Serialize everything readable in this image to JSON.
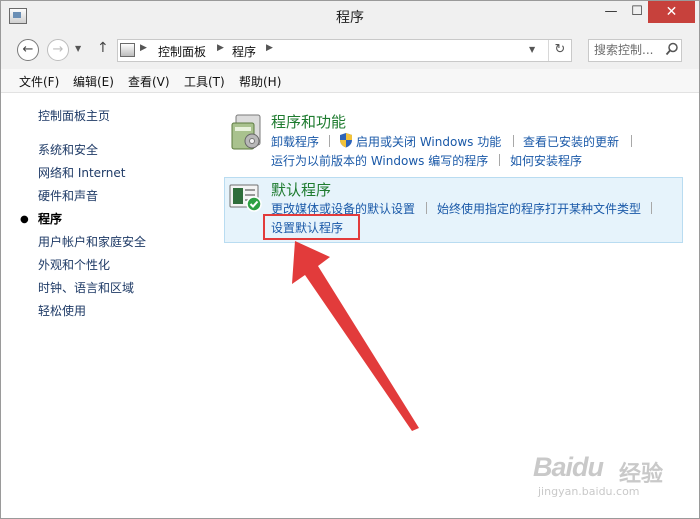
{
  "window": {
    "title": "程序",
    "controls": {
      "minimize": "—",
      "maximize": "☐",
      "close": "✕"
    }
  },
  "address": {
    "crumbs": [
      "控制面板",
      "程序"
    ],
    "search_placeholder": "搜索控制..."
  },
  "menu": [
    "文件(F)",
    "编辑(E)",
    "查看(V)",
    "工具(T)",
    "帮助(H)"
  ],
  "left_nav": {
    "items": [
      "控制面板主页",
      "系统和安全",
      "网络和 Internet",
      "硬件和声音",
      "程序",
      "用户帐户和家庭安全",
      "外观和个性化",
      "时钟、语言和区域",
      "轻松使用"
    ],
    "current_index": 4
  },
  "programs_features": {
    "title": "程序和功能",
    "links": [
      "卸载程序",
      "启用或关闭 Windows 功能",
      "查看已安装的更新",
      "运行为以前版本的 Windows 编写的程序",
      "如何安装程序"
    ]
  },
  "default_programs": {
    "title": "默认程序",
    "links": [
      "更改媒体或设备的默认设置",
      "始终使用指定的程序打开某种文件类型",
      "设置默认程序"
    ]
  },
  "annotation": {
    "highlight_color": "#e23b3b"
  },
  "watermark": {
    "brand": "Baidu",
    "brand_cn": "经验",
    "url": "jingyan.baidu.com"
  },
  "colors": {
    "link": "#1a59a8",
    "section_title": "#1e7b2f",
    "close_button": "#c7413c",
    "panel_bg": "#e6f3fb"
  }
}
